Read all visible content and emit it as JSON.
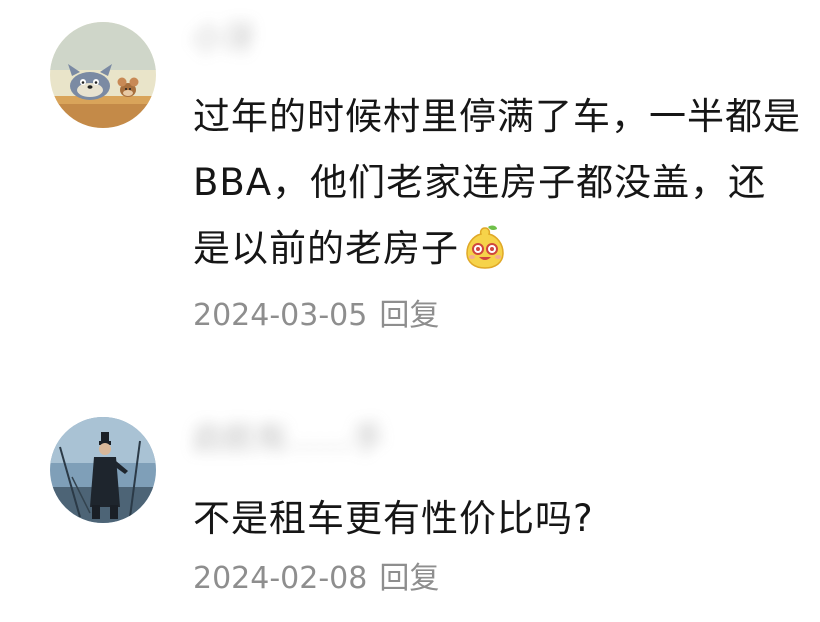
{
  "comments": [
    {
      "username": "小牙",
      "content": "过年的时候村里停满了车，一半都是BBA，他们老家连房子都没盖，还是以前的老房子",
      "emoji": "smiling-pear-emoji",
      "date": "2024-03-05",
      "reply_label": "回复"
    },
    {
      "username": "启航有……手",
      "content": "不是租车更有性价比吗?",
      "date": "2024-02-08",
      "reply_label": "回复"
    }
  ]
}
